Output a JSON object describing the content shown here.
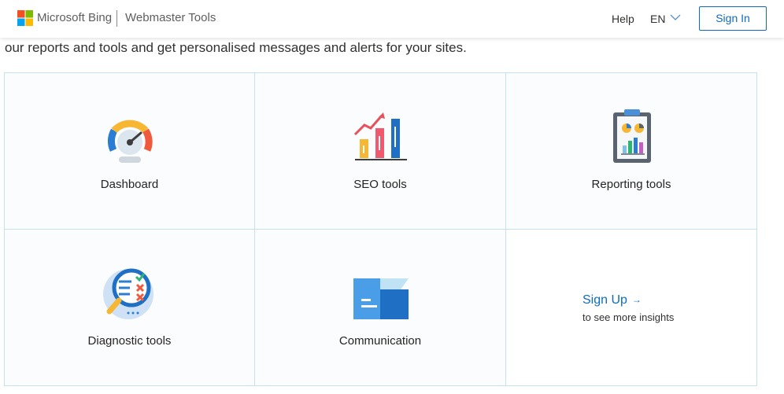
{
  "header": {
    "brand": "Microsoft Bing",
    "product": "Webmaster Tools",
    "help_label": "Help",
    "language": "EN",
    "signin_label": "Sign In"
  },
  "intro_text": "our reports and tools and get personalised messages and alerts for your sites.",
  "tiles": [
    {
      "label": "Dashboard",
      "icon": "speedometer-icon"
    },
    {
      "label": "SEO tools",
      "icon": "bar-chart-growth-icon"
    },
    {
      "label": "Reporting tools",
      "icon": "clipboard-report-icon"
    },
    {
      "label": "Diagnostic tools",
      "icon": "magnifier-checklist-icon"
    },
    {
      "label": "Communication",
      "icon": "open-box-message-icon"
    }
  ],
  "signup": {
    "link_label": "Sign Up",
    "arrow": "→",
    "subtext": "to see more insights"
  },
  "colors": {
    "accent": "#0f6cbd",
    "grid_border": "#c8e1ee"
  }
}
